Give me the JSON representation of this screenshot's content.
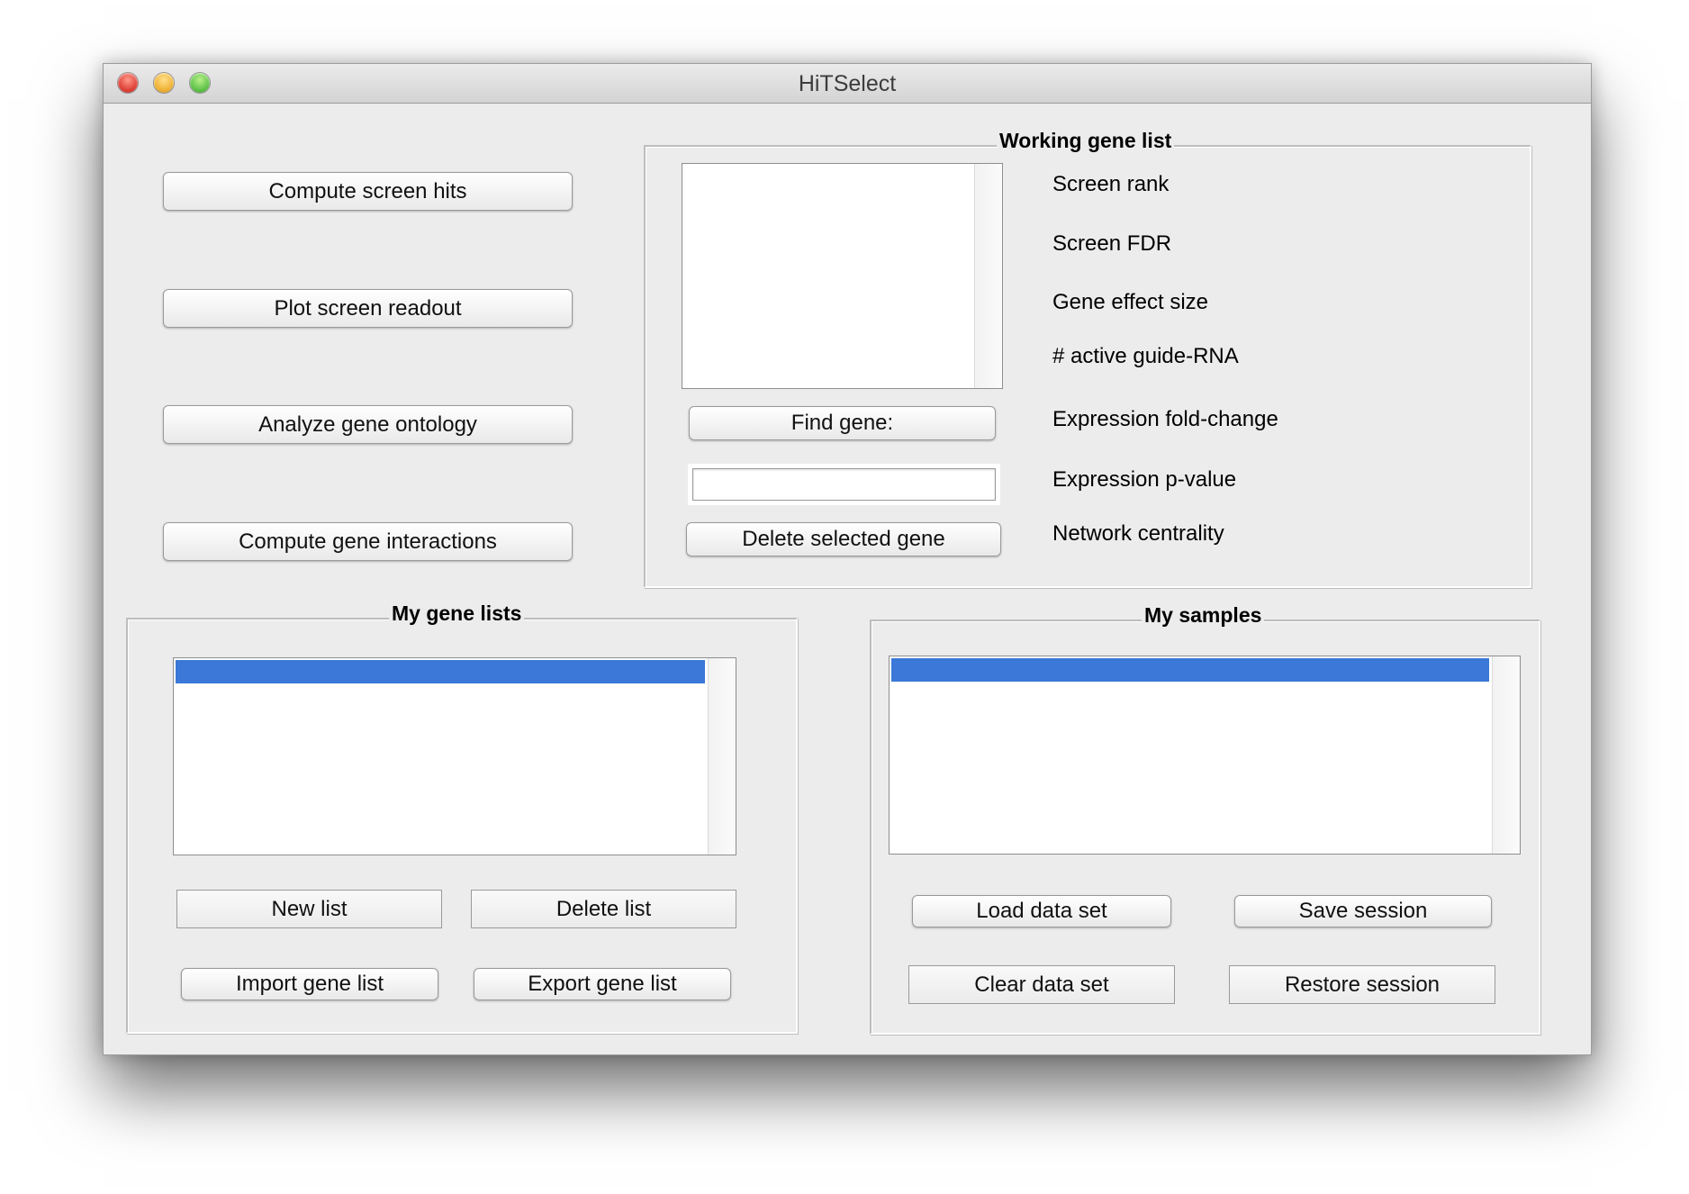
{
  "window": {
    "title": "HiTSelect"
  },
  "actions": {
    "compute_screen_hits": "Compute screen hits",
    "plot_screen_readout": "Plot screen readout",
    "analyze_gene_ontology": "Analyze gene ontology",
    "compute_gene_interactions": "Compute gene interactions"
  },
  "working_gene_list": {
    "title": "Working gene list",
    "find_gene_label": "Find gene:",
    "find_gene_value": "",
    "delete_selected_label": "Delete selected gene",
    "metrics": [
      "Screen rank",
      "Screen FDR",
      "Gene effect size",
      "# active guide-RNA",
      "Expression fold-change",
      "Expression p-value",
      "Network centrality"
    ]
  },
  "my_gene_lists": {
    "title": "My gene lists",
    "new_list": "New list",
    "delete_list": "Delete list",
    "import_gene_list": "Import gene list",
    "export_gene_list": "Export gene list"
  },
  "my_samples": {
    "title": "My samples",
    "load_data_set": "Load data set",
    "save_session": "Save session",
    "clear_data_set": "Clear data set",
    "restore_session": "Restore session"
  },
  "colors": {
    "selection": "#3b78d8",
    "window_bg": "#ececec"
  }
}
